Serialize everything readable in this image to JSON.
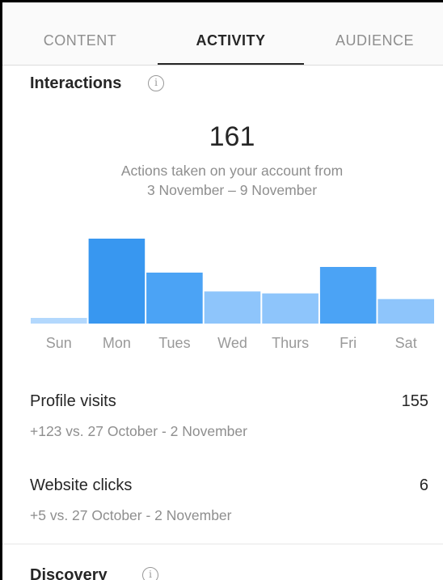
{
  "tabs": [
    {
      "label": "CONTENT"
    },
    {
      "label": "ACTIVITY"
    },
    {
      "label": "AUDIENCE"
    }
  ],
  "active_tab": "ACTIVITY",
  "interactions": {
    "title": "Interactions",
    "info_glyph": "i",
    "total": "161",
    "subtitle_line1": "Actions taken on your account from",
    "subtitle_line2": "3 November – 9 November"
  },
  "chart_data": {
    "type": "bar",
    "categories": [
      "Sun",
      "Mon",
      "Tues",
      "Wed",
      "Thurs",
      "Fri",
      "Sat"
    ],
    "values": [
      3,
      45,
      27,
      17,
      16,
      30,
      13
    ],
    "highlight_index": 1,
    "colors": {
      "bar": "#4ba3f5",
      "highlight": "#3897f0",
      "light": "#8ec5fb",
      "lighter": "#b3d8fd"
    }
  },
  "stats": {
    "profile_visits": {
      "label": "Profile visits",
      "value": "155",
      "compare": "+123 vs. 27 October - 2 November"
    },
    "website_clicks": {
      "label": "Website clicks",
      "value": "6",
      "compare": "+5 vs. 27 October - 2 November"
    }
  },
  "discovery": {
    "title": "Discovery",
    "info_glyph": "i"
  }
}
